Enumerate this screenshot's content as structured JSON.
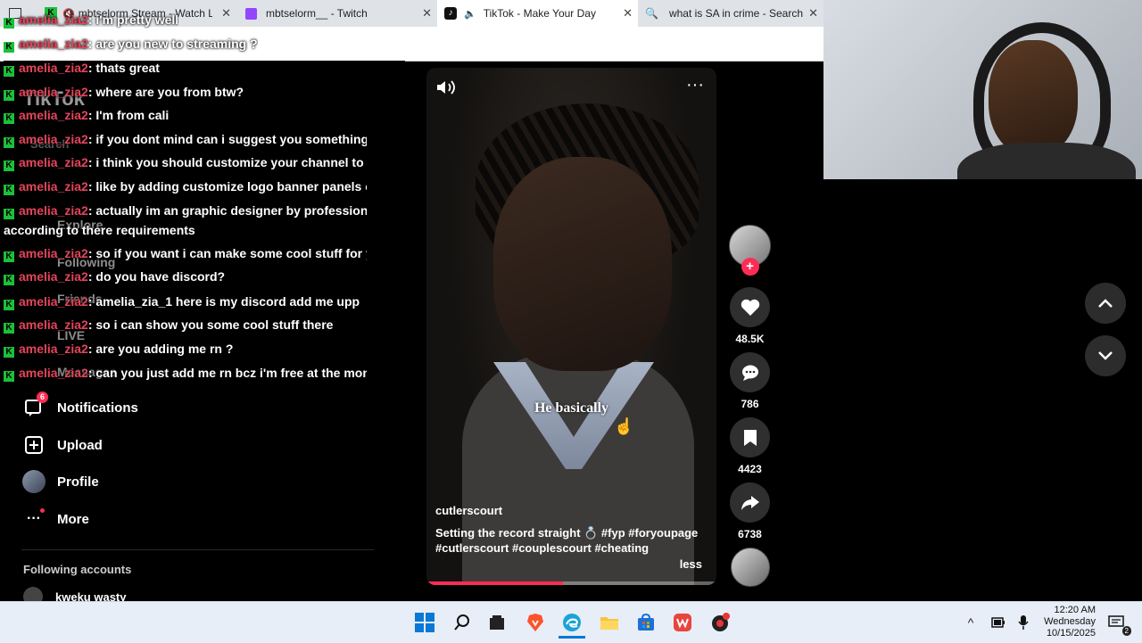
{
  "browser": {
    "tabs": [
      {
        "label": "mbtselorm Stream - Watch L",
        "active": false
      },
      {
        "label": "mbtselorm__ - Twitch",
        "active": false
      },
      {
        "label": "TikTok - Make Your Day",
        "active": true
      },
      {
        "label": "what is SA in crime - Search",
        "active": false
      }
    ]
  },
  "sidebar": {
    "logo": "TikTok",
    "search_placeholder": "Search",
    "items": [
      {
        "label": "Explore",
        "icon": "compass-icon"
      },
      {
        "label": "Following",
        "icon": "following-icon"
      },
      {
        "label": "Friends",
        "icon": "friends-icon"
      },
      {
        "label": "LIVE",
        "icon": "live-icon"
      },
      {
        "label": "Messages",
        "icon": "messages-icon"
      },
      {
        "label": "Notifications",
        "icon": "notifications-icon",
        "badge": "6"
      },
      {
        "label": "Upload",
        "icon": "upload-icon"
      },
      {
        "label": "Profile",
        "icon": "profile-avatar"
      },
      {
        "label": "More",
        "icon": "more-icon"
      }
    ],
    "following_header": "Following accounts",
    "following_accounts": [
      "kweku wasty"
    ]
  },
  "chat": {
    "messages": [
      {
        "user": "amelia_zia2",
        "text": ": i'm pretty well"
      },
      {
        "user": "amelia_zia2",
        "text": ": are you new to streaming ?"
      },
      {
        "user": "amelia_zia2",
        "text": ": thats great"
      },
      {
        "user": "amelia_zia2",
        "text": ": where are you from btw?"
      },
      {
        "user": "amelia_zia2",
        "text": ": I'm from cali"
      },
      {
        "user": "amelia_zia2",
        "text": ": if you dont mind can i suggest you something"
      },
      {
        "user": "amelia_zia2",
        "text": ": i think you should customize your channel to g"
      },
      {
        "user": "amelia_zia2",
        "text": ": like by adding customize logo banner panels o"
      },
      {
        "user": "amelia_zia2",
        "text": ": actually im an graphic designer by profession"
      },
      {
        "user": "",
        "text": "according to there requirements"
      },
      {
        "user": "amelia_zia2",
        "text": ": so if you want i can make some cool stuff for y"
      },
      {
        "user": "amelia_zia2",
        "text": ": do you have discord?"
      },
      {
        "user": "amelia_zia2",
        "text": ": amelia_zia_1 here is my discord add me upp"
      },
      {
        "user": "amelia_zia2",
        "text": ": so i can show you some cool stuff there"
      },
      {
        "user": "amelia_zia2",
        "text": ": are you adding me rn ?"
      },
      {
        "user": "amelia_zia2",
        "text": ": can you just add me rn bcz i'm free at the mon"
      }
    ]
  },
  "video": {
    "caption": "He basically",
    "author": "cutlerscourt",
    "description": "Setting the record straight 💍 #fyp  #foryoupage  #cutlerscourt  #couplescourt  #cheating",
    "less_label": "less",
    "progress": 0.47
  },
  "actions": {
    "likes": "48.5K",
    "comments": "786",
    "saves": "4423",
    "shares": "6738"
  },
  "taskbar": {
    "time": "12:20 AM",
    "day": "Wednesday",
    "date": "10/15/2025",
    "notification_count": "2"
  },
  "colors": {
    "accent": "#fe2c55",
    "chat_user": "#e6445a",
    "kick_green": "#1cbf3a"
  }
}
